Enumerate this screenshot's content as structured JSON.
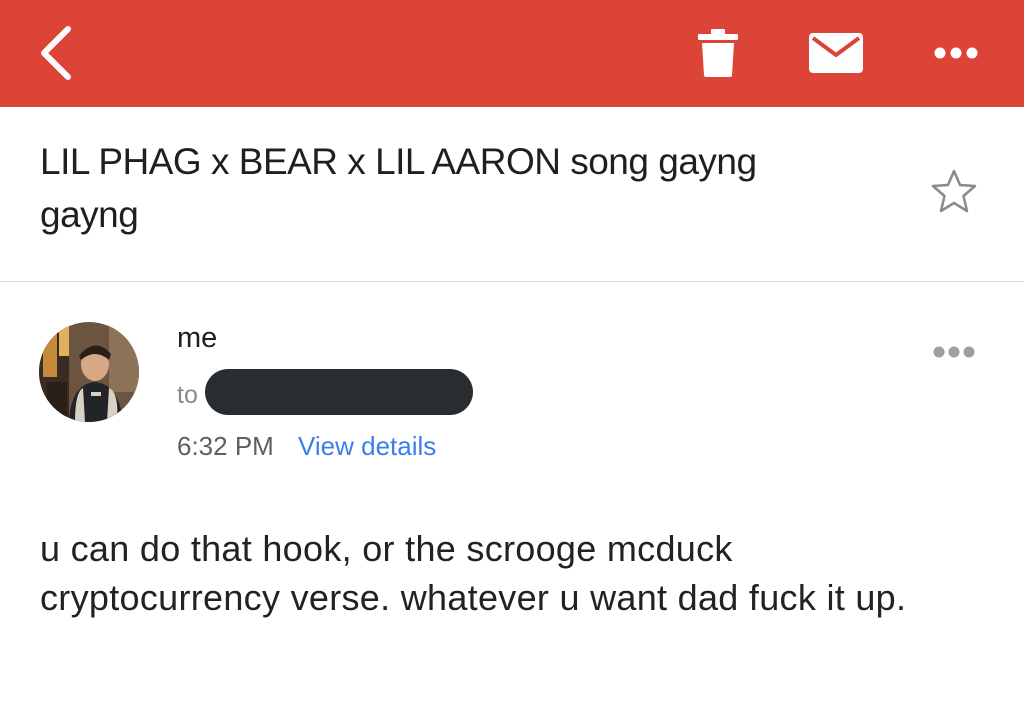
{
  "toolbar": {
    "background": "#db4437",
    "icons": [
      "back-arrow-icon",
      "trash-icon",
      "mail-icon",
      "more-options-icon"
    ]
  },
  "subject": {
    "text": "LIL PHAG x BEAR x LIL AARON song gayng gayng",
    "star_icon": "star-outline-icon"
  },
  "message": {
    "sender": "me",
    "to_label": "to",
    "recipient": "",
    "time": "6:32 PM",
    "details_link": "View details",
    "more_icon": "more-options-icon",
    "body": "u can do that hook, or the scrooge mcduck cryptocurrency verse. whatever u want dad fuck it up."
  },
  "colors": {
    "accent": "#db4437",
    "link": "#3b7ded",
    "redaction": "#2a2d30"
  }
}
